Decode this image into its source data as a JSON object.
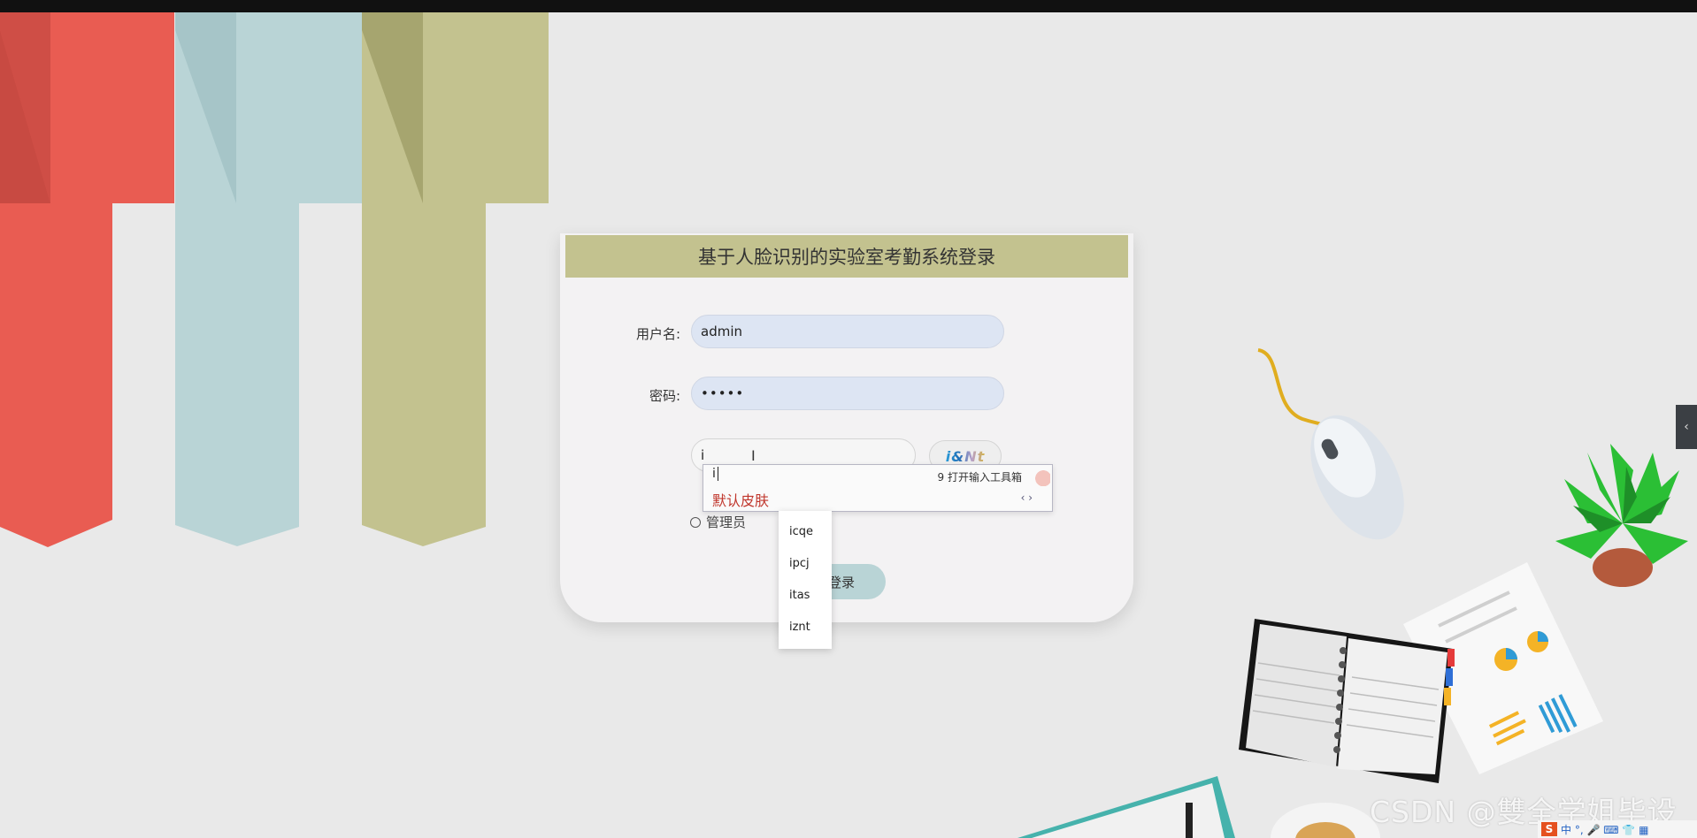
{
  "login": {
    "title": "基于人脸识别的实验室考勤系统登录",
    "username_label": "用户名:",
    "username_value": "admin",
    "password_label": "密码:",
    "password_value": "•••••",
    "captcha_value": "i",
    "captcha_image_text": "i&Nt",
    "role_label": "管理员",
    "submit_label": "登录"
  },
  "ime": {
    "composition": "i",
    "toolbox_label": "9 打开输入工具箱",
    "candidate": "默认皮肤",
    "nav": "‹ ›"
  },
  "autocomplete": {
    "items": [
      "icqe",
      "ipcj",
      "itas",
      "iznt"
    ]
  },
  "watermark": "CSDN @雙全学姐毕设",
  "side_tab_glyph": "‹",
  "tray": {
    "logo": "S",
    "text": "中 °, 🎤 ⌨ 👕 ▦"
  },
  "colors": {
    "ribbon_red": "#e95c52",
    "ribbon_blue": "#b9d4d6",
    "ribbon_olive": "#c3c28f",
    "header": "#c3c28f",
    "button": "#b9d4d6",
    "candidate": "#c0362c"
  }
}
